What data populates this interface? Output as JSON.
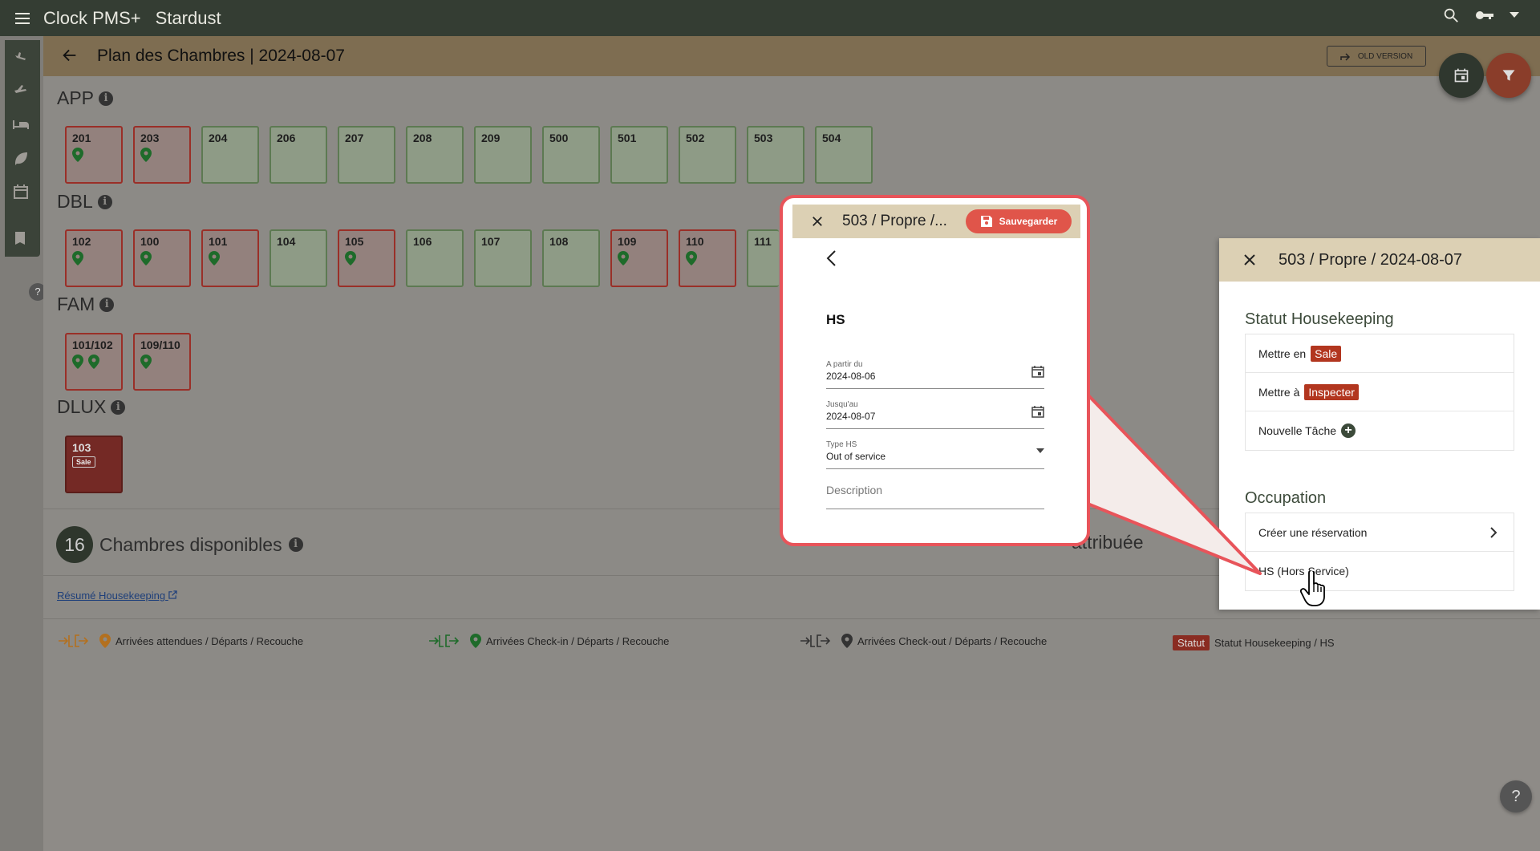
{
  "topbar": {
    "app_title": "Clock PMS+",
    "hotel": "Stardust"
  },
  "header": {
    "title": "Plan des Chambres | 2024-08-07",
    "old_version": "OLD VERSION"
  },
  "categories": [
    {
      "name": "APP",
      "rooms": [
        "201",
        "203",
        "204",
        "206",
        "207",
        "208",
        "209",
        "500",
        "501",
        "502",
        "503",
        "504"
      ]
    },
    {
      "name": "DBL",
      "rooms": [
        "102",
        "100",
        "101",
        "104",
        "105",
        "106",
        "107",
        "108",
        "109",
        "110",
        "111"
      ]
    },
    {
      "name": "FAM",
      "rooms": [
        "101/102",
        "109/110"
      ]
    },
    {
      "name": "DLUX",
      "rooms": [
        "103"
      ]
    }
  ],
  "dirty_badge": "Sale",
  "available": {
    "count": "16",
    "label": "Chambres disponibles"
  },
  "attributed_label": "attribuée",
  "hk_link": "Résumé Housekeeping",
  "legend": {
    "expected": "Arrivées attendues / Départs / Recouche",
    "checkin": "Arrivées Check-in / Départs / Recouche",
    "checkout": "Arrivées Check-out / Départs / Recouche",
    "statut_badge": "Statut",
    "statut": "Statut Housekeeping / HS"
  },
  "panel": {
    "title": "503 / Propre / 2024-08-07",
    "hk_section": "Statut Housekeeping",
    "mettre_en": "Mettre en",
    "sale": "Sale",
    "mettre_a": "Mettre à",
    "inspecter": "Inspecter",
    "nouvelle_tache": "Nouvelle Tâche",
    "occupation_section": "Occupation",
    "creer_reservation": "Créer une réservation",
    "hs": "HS (Hors Service)"
  },
  "callout": {
    "title": "503 / Propre /...",
    "save": "Sauvegarder",
    "heading": "HS",
    "from_label": "A partir du",
    "from_value": "2024-08-06",
    "to_label": "Jusqu'au",
    "to_value": "2024-08-07",
    "type_label": "Type HS",
    "type_value": "Out of service",
    "description": "Description"
  },
  "colors": {
    "topbar": "#343d33",
    "header": "#7e6d51",
    "accent_red": "#b2361f",
    "callout_border": "#e8545a"
  }
}
